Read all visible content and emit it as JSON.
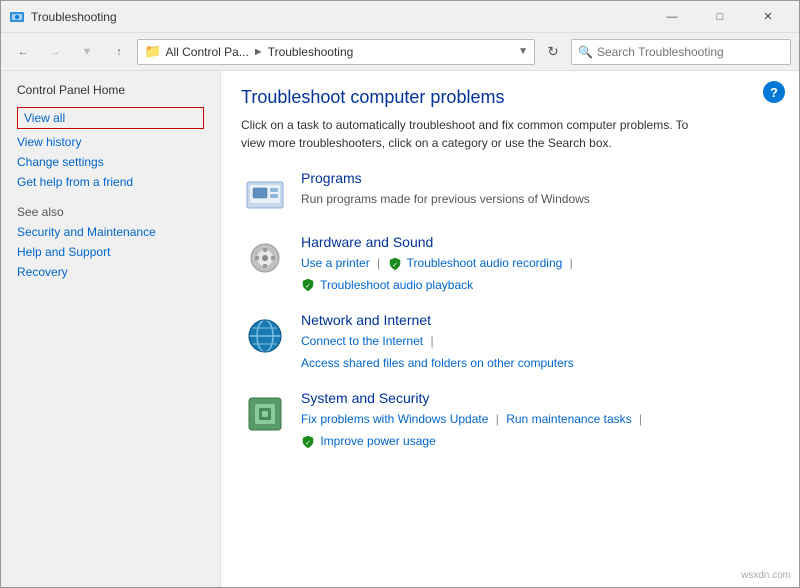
{
  "window": {
    "title": "Troubleshooting",
    "controls": {
      "minimize": "—",
      "maximize": "□",
      "close": "✕"
    }
  },
  "addressbar": {
    "back_tooltip": "Back",
    "forward_tooltip": "Forward",
    "up_tooltip": "Up",
    "breadcrumb_icon": "📁",
    "breadcrumb_folder": "All Control Pa...",
    "breadcrumb_current": "Troubleshooting",
    "search_placeholder": "Search Troubleshooting"
  },
  "sidebar": {
    "home_label": "Control Panel Home",
    "links": [
      {
        "id": "view-all",
        "label": "View all",
        "highlighted": true
      },
      {
        "id": "view-history",
        "label": "View history",
        "highlighted": false
      },
      {
        "id": "change-settings",
        "label": "Change settings",
        "highlighted": false
      },
      {
        "id": "get-help",
        "label": "Get help from a friend",
        "highlighted": false
      }
    ],
    "see_also_title": "See also",
    "see_also_links": [
      {
        "id": "security",
        "label": "Security and Maintenance"
      },
      {
        "id": "help",
        "label": "Help and Support"
      },
      {
        "id": "recovery",
        "label": "Recovery"
      }
    ]
  },
  "content": {
    "title": "Troubleshoot computer problems",
    "description": "Click on a task to automatically troubleshoot and fix common computer problems. To view more troubleshooters, click on a category or use the Search box.",
    "categories": [
      {
        "id": "programs",
        "title": "Programs",
        "subtitle": "Run programs made for previous versions of Windows",
        "links": []
      },
      {
        "id": "hardware",
        "title": "Hardware and Sound",
        "subtitle": "",
        "links": [
          {
            "label": "Use a printer",
            "shield": false
          },
          {
            "label": "Troubleshoot audio recording",
            "shield": true
          },
          {
            "label": "Troubleshoot audio playback",
            "shield": true
          }
        ]
      },
      {
        "id": "network",
        "title": "Network and Internet",
        "subtitle": "",
        "links": [
          {
            "label": "Connect to the Internet",
            "shield": false
          },
          {
            "label": "Access shared files and folders on other computers",
            "shield": false
          }
        ]
      },
      {
        "id": "system",
        "title": "System and Security",
        "subtitle": "",
        "links": [
          {
            "label": "Fix problems with Windows Update",
            "shield": false
          },
          {
            "label": "Run maintenance tasks",
            "shield": false
          },
          {
            "label": "Improve power usage",
            "shield": true
          }
        ]
      }
    ]
  }
}
